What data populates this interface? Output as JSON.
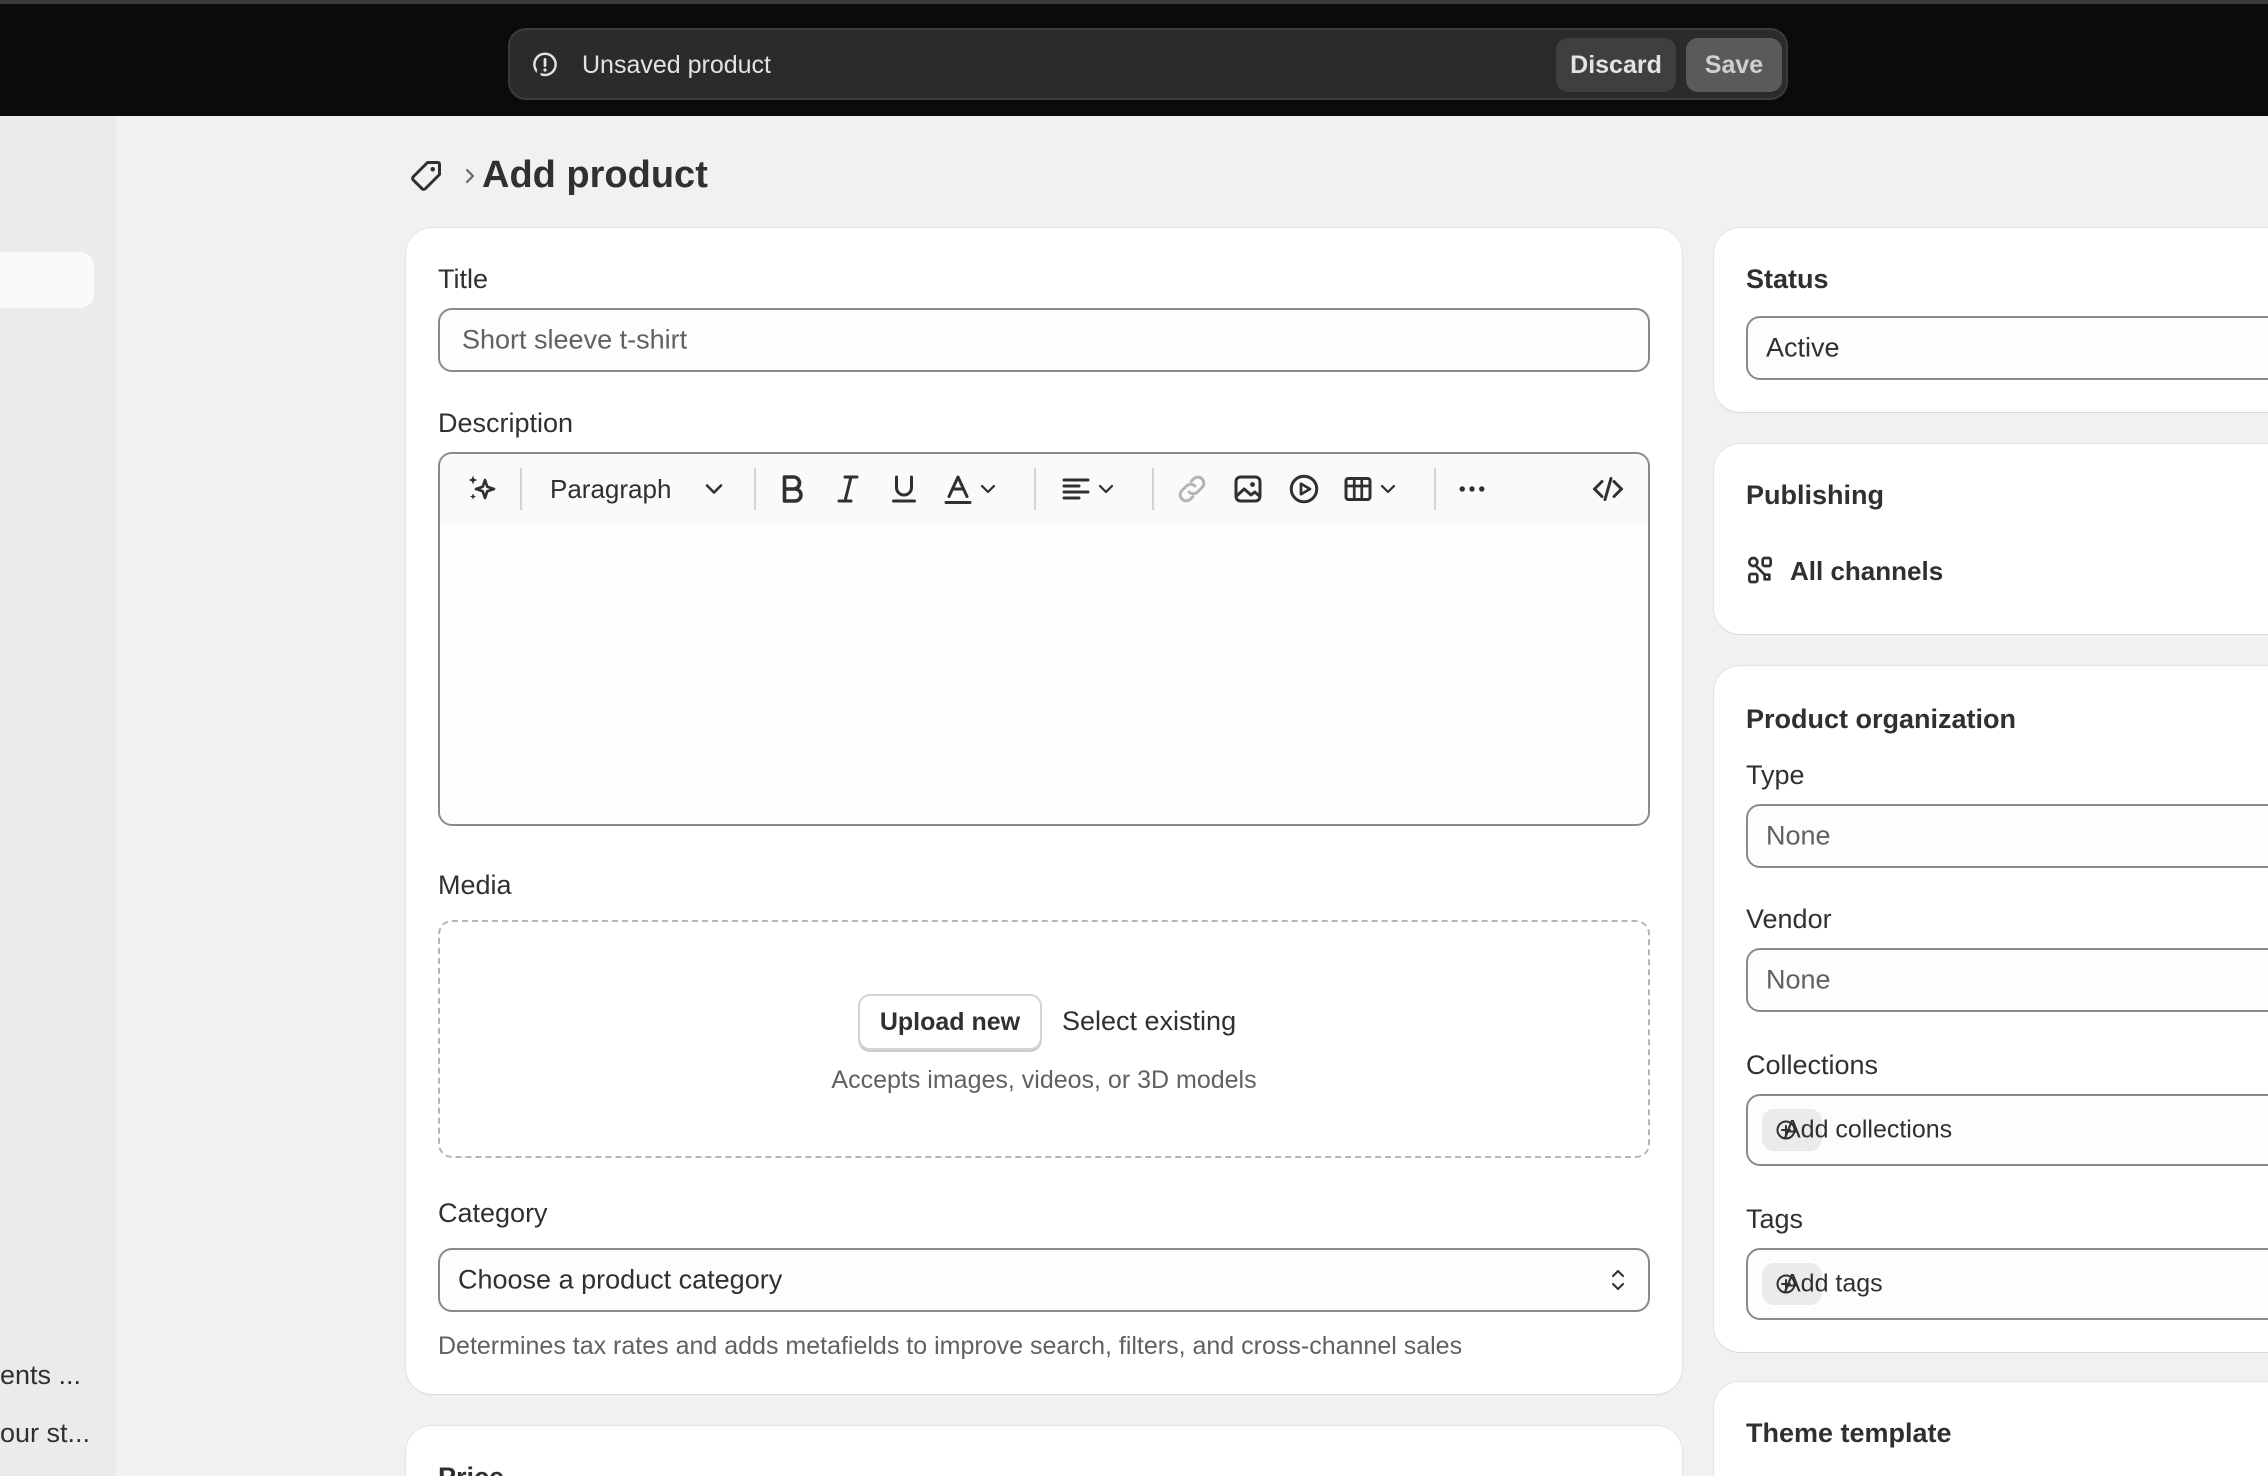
{
  "save_bar": {
    "message": "Unsaved product",
    "discard_label": "Discard",
    "save_label": "Save"
  },
  "left_nav": {
    "items_truncated": [
      "ents ...",
      "our st..."
    ]
  },
  "header": {
    "title": "Add product"
  },
  "product": {
    "title_label": "Title",
    "title_placeholder": "Short sleeve t-shirt",
    "description_label": "Description",
    "editor": {
      "paragraph_style": "Paragraph"
    },
    "media_label": "Media",
    "upload_label": "Upload new",
    "select_existing_label": "Select existing",
    "media_hint": "Accepts images, videos, or 3D models",
    "category_label": "Category",
    "category_placeholder": "Choose a product category",
    "category_helper": "Determines tax rates and adds metafields to improve search, filters, and cross-channel sales",
    "price_label": "Price"
  },
  "status": {
    "heading": "Status",
    "value": "Active"
  },
  "publishing": {
    "heading": "Publishing",
    "channels_label": "All channels"
  },
  "organization": {
    "heading": "Product organization",
    "type_label": "Type",
    "type_value": "None",
    "vendor_label": "Vendor",
    "vendor_value": "None",
    "collections_label": "Collections",
    "add_collections_label": "Add collections",
    "tags_label": "Tags",
    "add_tags_label": "Add tags"
  },
  "theme": {
    "heading": "Theme template"
  },
  "colors": {
    "topbar_bg": "#0b0b0b",
    "page_bg": "#f1f1f1",
    "card_bg": "#ffffff",
    "text": "#303030",
    "muted_text": "#616161"
  }
}
